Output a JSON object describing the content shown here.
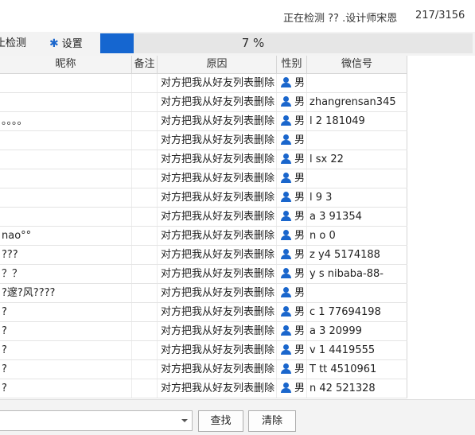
{
  "titlebar": {
    "status": "正在检测 ?? .设计师宋恩",
    "count": "217/3156"
  },
  "toolbar": {
    "stop_label": "止检测",
    "settings_label": "设置",
    "progress_percent": 7,
    "progress_text": "7 %"
  },
  "table": {
    "columns": {
      "nickname": "昵称",
      "note": "备注",
      "reason": "原因",
      "gender": "性别",
      "wechat": "微信号"
    },
    "rows": [
      {
        "nickname": "",
        "note": "",
        "reason": "对方把我从好友列表删除",
        "gender": "男",
        "wechat": ""
      },
      {
        "nickname": "",
        "note": "",
        "reason": "对方把我从好友列表删除",
        "gender": "男",
        "wechat": "zhangrensan345"
      },
      {
        "nickname": "。。。。",
        "note": "",
        "reason": "对方把我从好友列表删除",
        "gender": "男",
        "wechat": "l 2  181049"
      },
      {
        "nickname": "",
        "note": "",
        "reason": "对方把我从好友列表删除",
        "gender": "男",
        "wechat": ""
      },
      {
        "nickname": "",
        "note": "",
        "reason": "对方把我从好友列表删除",
        "gender": "男",
        "wechat": "l sx 22"
      },
      {
        "nickname": "",
        "note": "",
        "reason": "对方把我从好友列表删除",
        "gender": "男",
        "wechat": ""
      },
      {
        "nickname": "",
        "note": "",
        "reason": "对方把我从好友列表删除",
        "gender": "男",
        "wechat": "l  9  3"
      },
      {
        "nickname": "",
        "note": "",
        "reason": "对方把我从好友列表删除",
        "gender": "男",
        "wechat": "a  3  91354"
      },
      {
        "nickname": "nao°°",
        "note": "",
        "reason": "对方把我从好友列表删除",
        "gender": "男",
        "wechat": "n  o  0"
      },
      {
        "nickname": "???",
        "note": "",
        "reason": "对方把我从好友列表删除",
        "gender": "男",
        "wechat": "z  y4  5174188"
      },
      {
        "nickname": "？？",
        "note": "",
        "reason": "对方把我从好友列表删除",
        "gender": "男",
        "wechat": "y  s  nibaba-88-"
      },
      {
        "nickname": "?邃?风????",
        "note": "",
        "reason": "对方把我从好友列表删除",
        "gender": "男",
        "wechat": ""
      },
      {
        "nickname": "?",
        "note": "",
        "reason": "对方把我从好友列表删除",
        "gender": "男",
        "wechat": "c  1  77694198"
      },
      {
        "nickname": "?",
        "note": "",
        "reason": "对方把我从好友列表删除",
        "gender": "男",
        "wechat": "a  3  20999"
      },
      {
        "nickname": "?",
        "note": "",
        "reason": "对方把我从好友列表删除",
        "gender": "男",
        "wechat": "v  1  4419555"
      },
      {
        "nickname": "?",
        "note": "",
        "reason": "对方把我从好友列表删除",
        "gender": "男",
        "wechat": "T  tt  4510961"
      },
      {
        "nickname": "?",
        "note": "",
        "reason": "对方把我从好友列表删除",
        "gender": "男",
        "wechat": "n  42  521328"
      }
    ]
  },
  "bottom": {
    "search_value": "",
    "find_label": "查找",
    "clear_label": "清除"
  },
  "icons": {
    "settings": "gear-icon",
    "gender": "user-icon",
    "dropdown": "chevron-down-icon"
  },
  "colors": {
    "accent": "#1566d0",
    "progress_track": "#e6e6e6"
  }
}
